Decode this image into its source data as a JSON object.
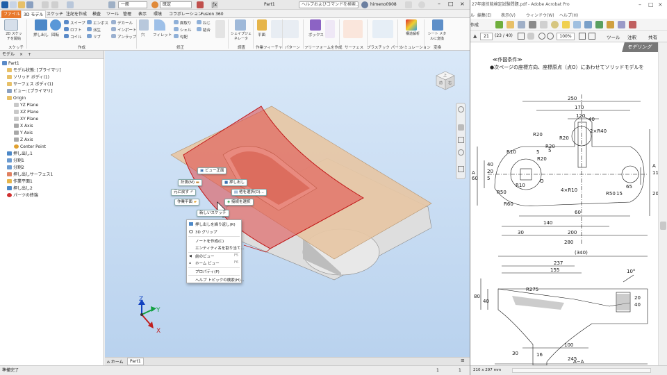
{
  "inventor": {
    "qat": {
      "material": "一般",
      "appearance": "既定",
      "doc_title": "Part1",
      "search_placeholder": "ヘルプおよびコマンドを検索...",
      "user": "himeno0908"
    },
    "tabs": [
      "ファイル",
      "3D モデル",
      "スケッチ",
      "注記を作成",
      "検査",
      "ツール",
      "管理",
      "表示",
      "環境",
      "コラボレーション",
      "Fusion 360"
    ],
    "ribbon": {
      "sketch_start": "2D スケッチを開始",
      "extrude": "押し出し",
      "revolve": "回転",
      "sweep": "スイープ",
      "loft": "ロフト",
      "coil": "コイル",
      "emboss": "エンボス",
      "derive": "派生",
      "rib": "リブ",
      "decal": "デカール",
      "import": "インポート",
      "unwrap": "アンラップ",
      "hole": "穴",
      "fillet": "フィレット",
      "chamfer": "面取り",
      "thread": "ねじ",
      "shell": "シェル",
      "combine": "結合",
      "draft": "勾配",
      "shape_generator": "シェイプジェネレータ",
      "plane": "平面",
      "box": "ボックス",
      "stress_analysis": "構造解析",
      "convert_sheet_metal": "シート メタルに変換",
      "groups": [
        "スケッチ",
        "作成",
        "修正",
        "調査",
        "作業フィーチャ",
        "パターン",
        "フリーフォームを作成",
        "サーフェス",
        "プラスチック パーツ",
        "シミュレーション",
        "変換"
      ]
    },
    "browser": {
      "tab": "モデル",
      "items": [
        "Part1",
        "モデル状態: [プライマリ]",
        "ソリッド ボディ(1)",
        "サーフェス ボディ(1)",
        "ビュー: [プライマリ]",
        "Origin",
        "YZ Plane",
        "XZ Plane",
        "XY Plane",
        "X Axis",
        "Y Axis",
        "Z Axis",
        "Center Point",
        "押し出し1",
        "分割1",
        "分割2",
        "押し出しサーフェス1",
        "作業平面1",
        "押し出し2",
        "パーツの終端"
      ]
    },
    "viewcube": {
      "top": "上",
      "front": "前",
      "right": "右"
    },
    "marking_menu": {
      "view_front": "ビュー正面",
      "measure": "計測(M)",
      "extrude": "押し出し",
      "undo": "元に戻す",
      "loop_select": "他を選択(O)...",
      "work_plane": "作業平面",
      "tangent_select": "接続を選択",
      "new_sketch": "新しいスケッチ"
    },
    "context_menu": [
      {
        "label": "押し出しを繰り返し(R)",
        "shortcut": ""
      },
      {
        "label": "3D グリップ",
        "shortcut": ""
      },
      {
        "label": "ノートを作成(C)",
        "shortcut": ""
      },
      {
        "label": "エンティティ名を割り当て...",
        "shortcut": ""
      },
      {
        "label": "前のビュー",
        "shortcut": "F5"
      },
      {
        "label": "ホーム ビュー",
        "shortcut": "F6"
      },
      {
        "label": "プロパティ(P)",
        "shortcut": ""
      },
      {
        "label": "ヘルプ トピックの検索(H)...",
        "shortcut": ""
      }
    ],
    "axes": {
      "x": "X",
      "y": "Y",
      "z": "Z"
    },
    "doc_tabs": {
      "home": "ホーム",
      "part": "Part1"
    },
    "status": {
      "left": "準備完了",
      "n1": "1",
      "n2": "1"
    }
  },
  "acrobat": {
    "title": "27年度技能検定試験問題.pdf - Adobe Acrobat Pro",
    "menu": [
      "ル",
      "編集(E)",
      "表示(V)",
      "ウィンドウ(W)",
      "ヘルプ(H)"
    ],
    "toolbar_label": "作成",
    "page_current": "21",
    "page_info": "(23 / 40)",
    "zoom": "100%",
    "tools": [
      "ツール",
      "注釈",
      "共有"
    ],
    "heading_banner": "モデリング",
    "condition_title": "≪作図条件≫",
    "condition_text": "●次ページの座標方向、座標原点（点O）にあわせてソリッドモデルを",
    "section_label": "A−A",
    "page_size": "210 x 297 mm",
    "dims_plan": [
      "250",
      "170",
      "120",
      "40",
      "R20",
      "2×R40",
      "R20",
      "R20",
      "R10",
      "R10",
      "R20",
      "5",
      "5",
      "5",
      "20",
      "40",
      "60",
      "110",
      "200",
      "65",
      "R50",
      "R60",
      "15",
      "R50",
      "4×R10",
      "60",
      "140",
      "200",
      "280",
      "A",
      "A",
      "O",
      "30"
    ],
    "dims_section": [
      "(340)",
      "237",
      "155",
      "10°",
      "R275",
      "80",
      "40",
      "20",
      "40",
      "100",
      "30",
      "16",
      "245"
    ]
  }
}
